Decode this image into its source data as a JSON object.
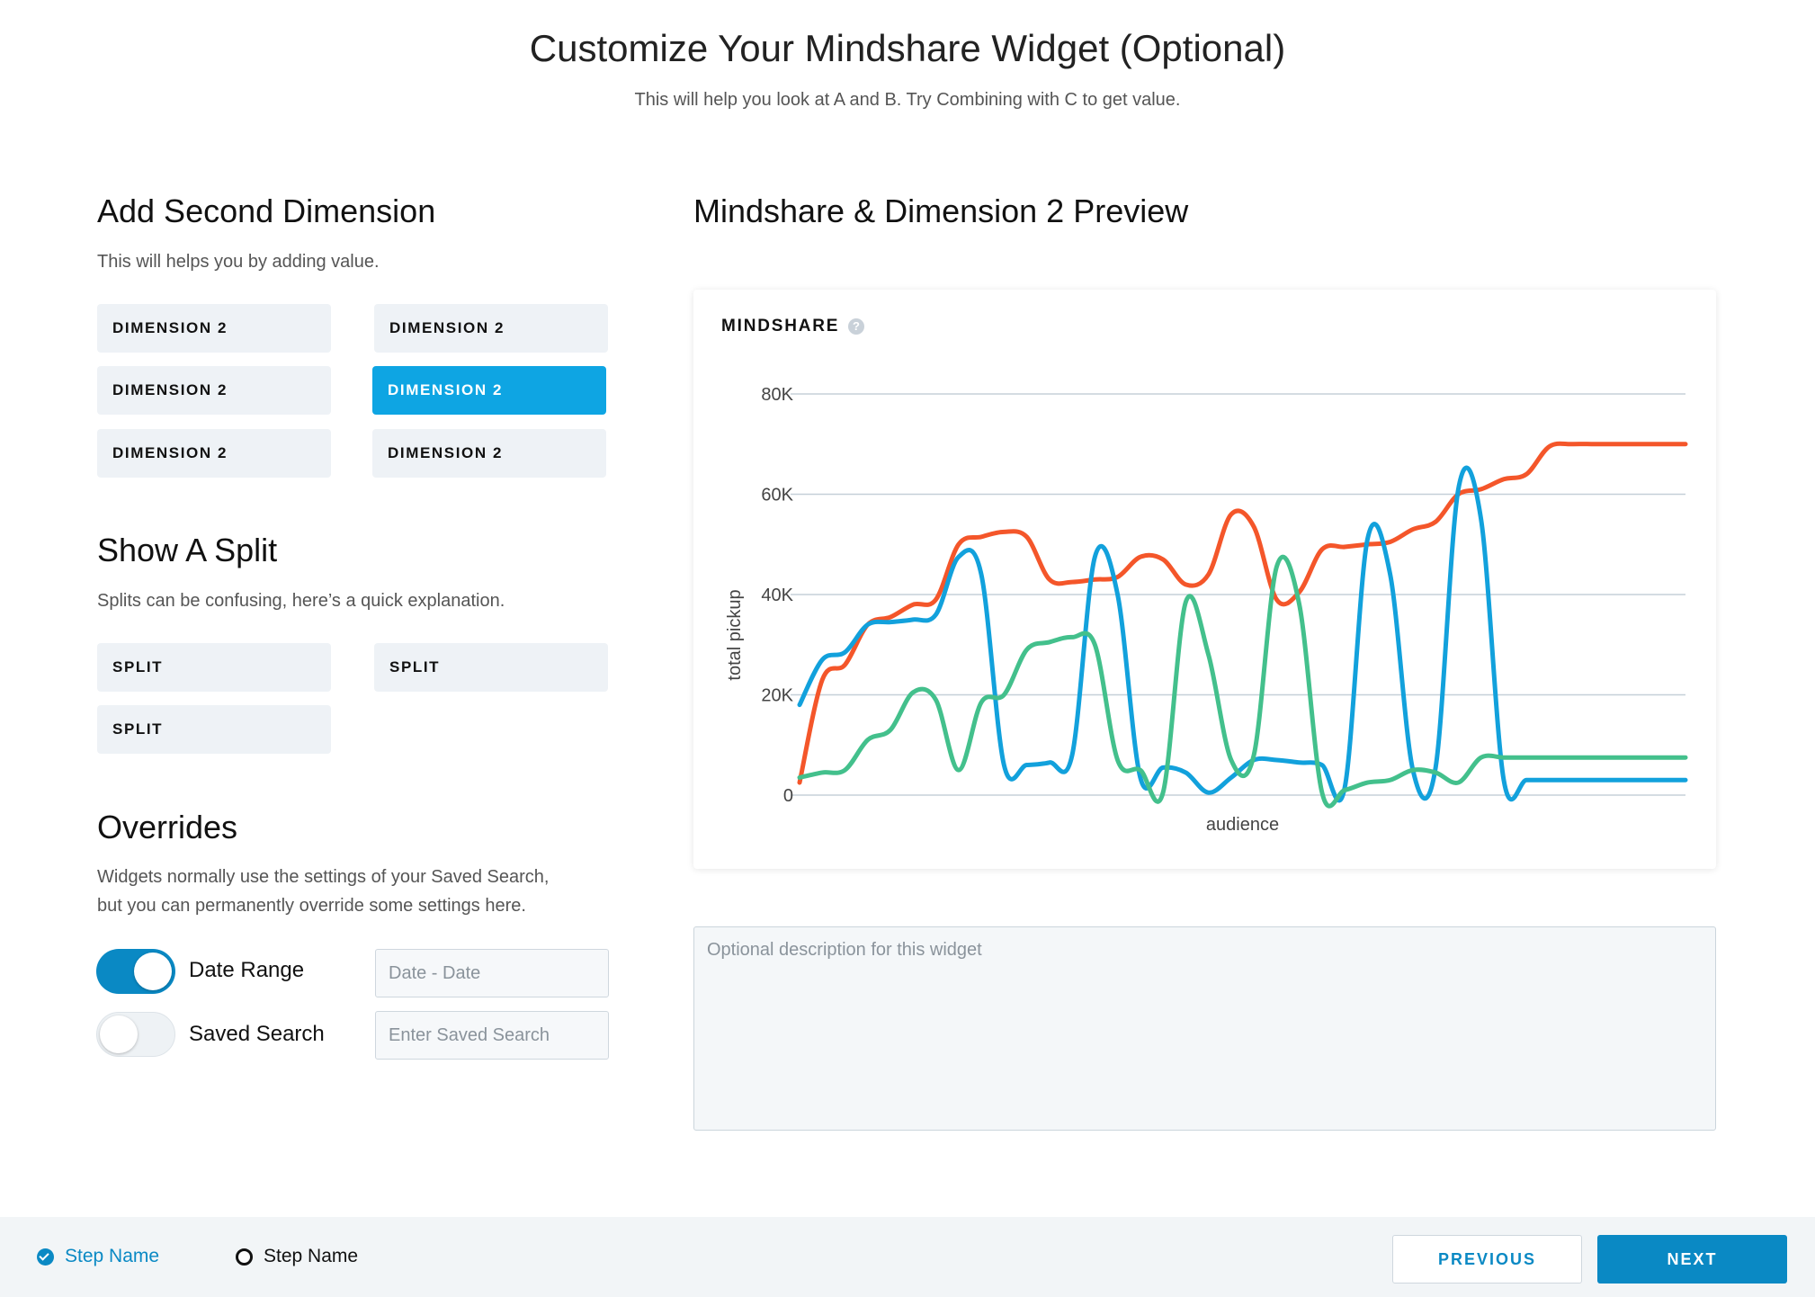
{
  "header": {
    "title": "Customize Your Mindshare Widget (Optional)",
    "subtitle": "This will help you look at A and B. Try Combining with C to get value."
  },
  "dimension_section": {
    "title": "Add Second Dimension",
    "description": "This will helps you by adding value.",
    "options": [
      "DIMENSION 2",
      "DIMENSION 2",
      "DIMENSION 2",
      "DIMENSION 2",
      "DIMENSION 2",
      "DIMENSION 2"
    ],
    "selected_index": 3
  },
  "split_section": {
    "title": "Show A Split",
    "description": "Splits can be confusing, here’s a quick explanation.",
    "options": [
      "SPLIT",
      "SPLIT",
      "SPLIT"
    ]
  },
  "overrides_section": {
    "title": "Overrides",
    "description_line1": "Widgets normally use the settings of your Saved Search,",
    "description_line2": "but you can permanently override some settings here.",
    "date_range": {
      "label": "Date Range",
      "enabled": true,
      "placeholder": "Date - Date",
      "value": ""
    },
    "saved_search": {
      "label": "Saved Search",
      "enabled": false,
      "placeholder": "Enter Saved Search",
      "value": ""
    }
  },
  "preview": {
    "title": "Mindshare & Dimension 2 Preview",
    "card_label": "MINDSHARE",
    "help_icon": "question-circle-icon"
  },
  "description_field": {
    "placeholder": "Optional description for this widget",
    "value": ""
  },
  "footer": {
    "steps": [
      {
        "label": "Step Name",
        "status": "complete",
        "icon": "check-circle-icon"
      },
      {
        "label": "Step Name",
        "status": "incomplete",
        "icon": "circle-icon"
      }
    ],
    "previous_label": "PREVIOUS",
    "next_label": "NEXT"
  },
  "colors": {
    "accent": "#0a89c4",
    "selected_option": "#0ea5e3",
    "series_orange": "#f4562a",
    "series_blue": "#12a1dc",
    "series_green": "#43c08c"
  },
  "chart_data": {
    "type": "line",
    "title": "",
    "xlabel": "audience",
    "ylabel": "total pickup",
    "ylim": [
      0,
      80000
    ],
    "yticks": [
      0,
      20000,
      40000,
      60000,
      80000
    ],
    "ytick_labels": [
      "0",
      "20K",
      "40K",
      "60K",
      "80K"
    ],
    "grid": true,
    "legend": "none",
    "x": [
      0,
      1,
      2,
      3,
      4,
      5,
      6,
      7,
      8,
      9,
      10,
      11,
      12,
      13,
      14,
      15,
      16,
      17,
      18,
      19,
      20,
      21,
      22,
      23,
      24,
      25,
      26,
      27,
      28,
      29,
      30,
      31,
      32,
      33,
      34,
      35,
      36,
      37,
      38,
      39
    ],
    "series": [
      {
        "color": "#f4562a",
        "values": [
          2500,
          23000,
          26000,
          34000,
          35500,
          38000,
          39000,
          50000,
          51500,
          52500,
          51500,
          43000,
          42500,
          43000,
          43500,
          47500,
          47000,
          42000,
          44000,
          56000,
          53500,
          39000,
          40500,
          49000,
          49500,
          50000,
          50500,
          53000,
          54500,
          60000,
          61000,
          63000,
          64000,
          69500,
          70000,
          70000,
          70000,
          70000,
          70000,
          70000
        ]
      },
      {
        "color": "#12a1dc",
        "values": [
          18000,
          27000,
          28500,
          34000,
          34500,
          35000,
          36000,
          47500,
          44000,
          6000,
          6000,
          6500,
          8000,
          47500,
          40000,
          3500,
          5500,
          4500,
          500,
          3500,
          7000,
          7000,
          6500,
          6000,
          1500,
          51000,
          44000,
          5000,
          5500,
          61000,
          55000,
          3000,
          3000,
          3000,
          3000,
          3000,
          3000,
          3000,
          3000,
          3000
        ]
      },
      {
        "color": "#43c08c",
        "values": [
          3500,
          4500,
          5000,
          11000,
          13000,
          20500,
          19000,
          5000,
          18500,
          20000,
          29000,
          30500,
          31500,
          30000,
          7000,
          5000,
          500,
          38500,
          28000,
          7000,
          8000,
          45500,
          38000,
          500,
          1000,
          2500,
          3000,
          5000,
          4500,
          2500,
          7500,
          7500,
          7500,
          7500,
          7500,
          7500,
          7500,
          7500,
          7500,
          7500
        ]
      }
    ]
  }
}
